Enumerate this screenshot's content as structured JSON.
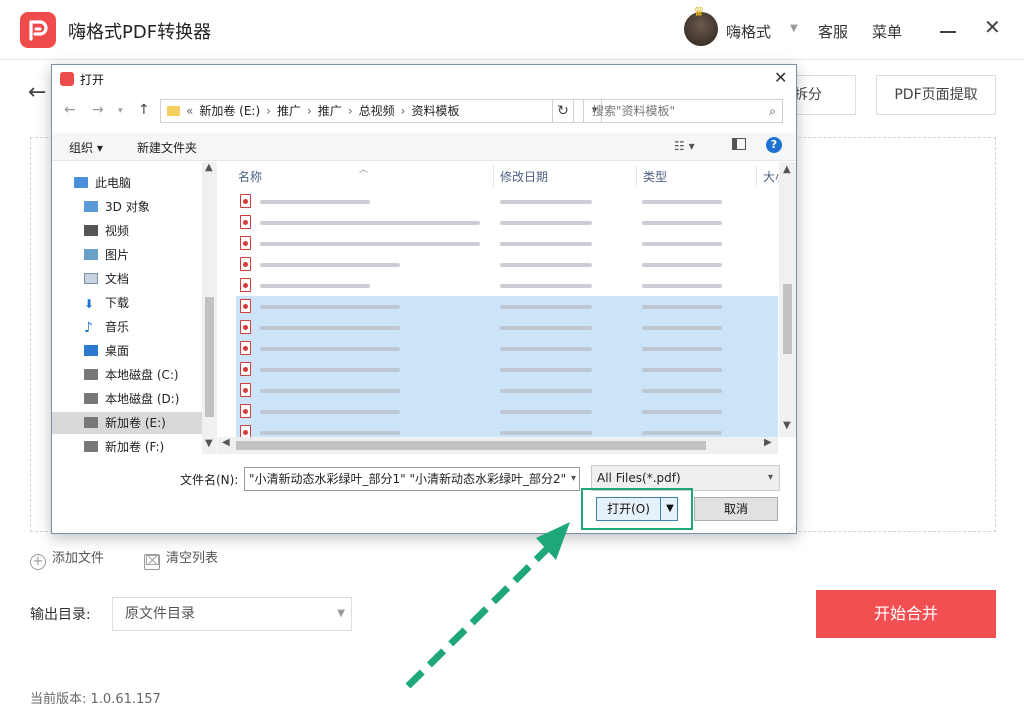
{
  "app": {
    "title": "嗨格式PDF转换器",
    "username": "嗨格式",
    "support": "客服",
    "menu": "菜单",
    "tabs": [
      "拆分",
      "PDF页面提取"
    ],
    "add_file": "添加文件",
    "clear_list": "清空列表",
    "output_label": "输出目录:",
    "output_value": "原文件目录",
    "start_button": "开始合并",
    "version": "当前版本: 1.0.61.157",
    "accent_color": "#f14f52"
  },
  "dialog": {
    "title": "打开",
    "address": {
      "prefix": "«",
      "segments": [
        "新加卷 (E:)",
        "推广",
        "推广",
        "总视频",
        "资料模板"
      ]
    },
    "search_placeholder": "搜索\"资料模板\"",
    "toolbar": {
      "organize": "组织 ▾",
      "new_folder": "新建文件夹"
    },
    "nav_items": [
      {
        "label": "此电脑",
        "icon": "computer-icon"
      },
      {
        "label": "3D 对象",
        "icon": "3d-objects-icon"
      },
      {
        "label": "视频",
        "icon": "video-icon"
      },
      {
        "label": "图片",
        "icon": "pictures-icon"
      },
      {
        "label": "文档",
        "icon": "documents-icon"
      },
      {
        "label": "下载",
        "icon": "download-icon"
      },
      {
        "label": "音乐",
        "icon": "music-icon"
      },
      {
        "label": "桌面",
        "icon": "desktop-icon"
      },
      {
        "label": "本地磁盘 (C:)",
        "icon": "drive-icon"
      },
      {
        "label": "本地磁盘 (D:)",
        "icon": "drive-icon"
      },
      {
        "label": "新加卷 (E:)",
        "icon": "drive-icon",
        "selected": true
      },
      {
        "label": "新加卷 (F:)",
        "icon": "drive-icon"
      }
    ],
    "columns": [
      "名称",
      "修改日期",
      "类型",
      "大小"
    ],
    "file_name_label": "文件名(N):",
    "file_name_value": "\"小清新动态水彩绿叶_部分1\" \"小清新动态水彩绿叶_部分2\"",
    "file_type": "All Files(*.pdf)",
    "open_button": "打开(O)",
    "cancel_button": "取消",
    "selection_color": "#cce4f7",
    "highlight_color": "#1fa77c"
  }
}
